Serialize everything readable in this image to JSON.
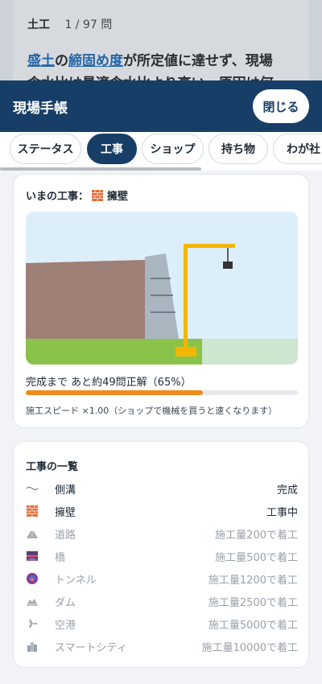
{
  "background": {
    "category": "土工",
    "counter": "1 / 97 問",
    "question_parts": [
      {
        "text": "盛土",
        "keyword": true
      },
      {
        "text": "の",
        "keyword": false
      },
      {
        "text": "締固め度",
        "keyword": true
      },
      {
        "text": "が所定値に達せず、現場",
        "keyword": false
      }
    ],
    "question_line2": "含水比は最適含水比より高い。原因は何"
  },
  "sheet": {
    "title": "現場手帳",
    "close_label": "閉じる",
    "tabs": [
      "ステータス",
      "工事",
      "ショップ",
      "持ち物",
      "わが社"
    ],
    "active_tab": 1
  },
  "current_work": {
    "label_prefix": "いまの工事：",
    "name": "擁壁",
    "icon": "brick-wall-icon",
    "progress_text": "完成まで あと約49問正解（65%）",
    "progress": 0.65,
    "speed_text": "施工スピード ×1.00（ショップで機械を買うと速くなります）"
  },
  "works": {
    "title": "工事の一覧",
    "items": [
      {
        "icon": "ditch-icon",
        "name": "側溝",
        "status": "完成",
        "state": "done"
      },
      {
        "icon": "brick-wall-icon",
        "name": "擁壁",
        "status": "工事中",
        "state": "active"
      },
      {
        "icon": "road-icon",
        "name": "道路",
        "status": "施工量200で着工",
        "state": "locked"
      },
      {
        "icon": "bridge-icon",
        "name": "橋",
        "status": "施工量500で着工",
        "state": "locked"
      },
      {
        "icon": "tunnel-icon",
        "name": "トンネル",
        "status": "施工量1200で着工",
        "state": "locked"
      },
      {
        "icon": "dam-icon",
        "name": "ダム",
        "status": "施工量2500で着工",
        "state": "locked"
      },
      {
        "icon": "airplane-icon",
        "name": "空港",
        "status": "施工量5000で着工",
        "state": "locked"
      },
      {
        "icon": "city-icon",
        "name": "スマートシティ",
        "status": "施工量10000で着工",
        "state": "locked"
      }
    ]
  },
  "colors": {
    "header": "#173e66",
    "progress": "#f08c1a",
    "crane": "#f2b705",
    "grass": "#8bc34a"
  }
}
